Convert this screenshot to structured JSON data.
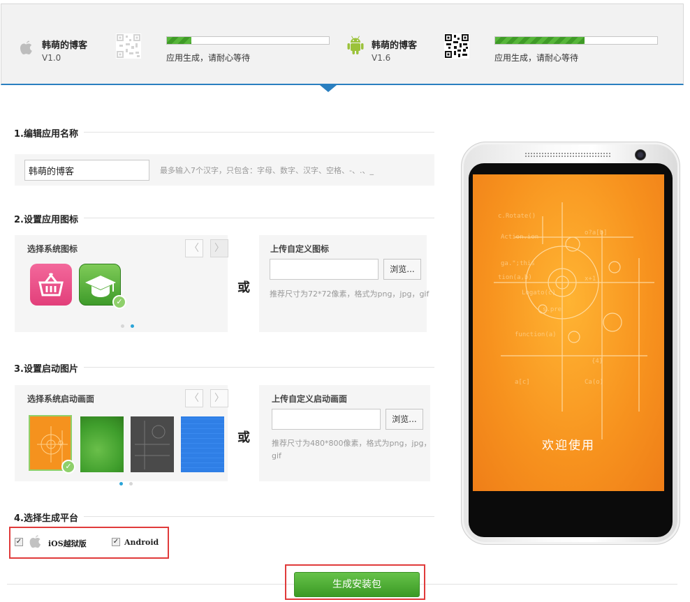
{
  "status_bar": {
    "ios": {
      "name": "韩萌的博客",
      "version": "V1.0",
      "progress": 0.15,
      "status": "应用生成，请耐心等待"
    },
    "android": {
      "name": "韩萌的博客",
      "version": "V1.6",
      "progress": 0.55,
      "status": "应用生成，请耐心等待"
    }
  },
  "section1": {
    "title": "1.编辑应用名称",
    "app_name_value": "韩萌的博客",
    "hint": "最多输入7个汉字，只包含：字母、数字、汉字、空格、-、.、_"
  },
  "section2": {
    "title": "2.设置应用图标",
    "system_title": "选择系统图标",
    "prev": "〈",
    "next": "〉",
    "or": "或",
    "custom_title": "上传自定义图标",
    "browse": "浏览...",
    "hint": "推荐尺寸为72*72像素，格式为png，jpg，gif",
    "icons": [
      "basket-icon",
      "graduation-cap-icon"
    ],
    "selected_index": 1,
    "page": 2,
    "pages": 2
  },
  "section3": {
    "title": "3.设置启动图片",
    "system_title": "选择系统启动画面",
    "prev": "〈",
    "next": "〉",
    "or": "或",
    "custom_title": "上传自定义启动画面",
    "browse": "浏览...",
    "hint": "推荐尺寸为480*800像素，格式为png，jpg，gif",
    "splash_colors": [
      "#f5921e",
      "#3f9e2c",
      "#4a4a4a",
      "#2f7fe6"
    ],
    "selected_index": 0,
    "page": 1,
    "pages": 2
  },
  "section4": {
    "title": "4.选择生成平台",
    "ios_label": "iOS越狱版",
    "ios_checked": true,
    "android_label": "Android",
    "android_checked": true
  },
  "generate_button": "生成安装包",
  "phone": {
    "welcome_text": "欢迎使用"
  },
  "colors": {
    "accent_blue": "#2a7fc0",
    "progress_green": "#4caf2f",
    "highlight_red": "#e03a3a",
    "button_green": "#4fae36"
  }
}
